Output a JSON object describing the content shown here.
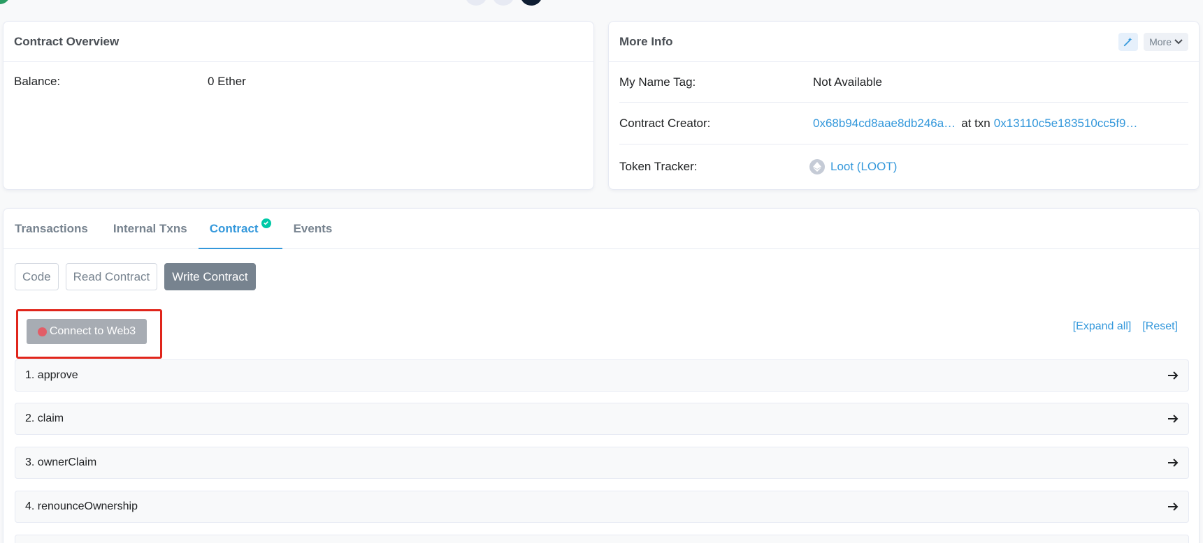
{
  "overview": {
    "title": "Contract Overview",
    "balance_label": "Balance:",
    "balance_value": "0 Ether"
  },
  "more_info": {
    "title": "More Info",
    "more_label": "More",
    "name_tag_label": "My Name Tag:",
    "name_tag_value": "Not Available",
    "creator_label": "Contract Creator:",
    "creator_address": "0x68b94cd8aae8db246a…",
    "at_txn_label": "at txn",
    "creator_txn": "0x13110c5e183510cc5f9…",
    "token_tracker_label": "Token Tracker:",
    "token_tracker_value": "Loot (LOOT)"
  },
  "tabs": [
    {
      "label": "Transactions"
    },
    {
      "label": "Internal Txns"
    },
    {
      "label": "Contract"
    },
    {
      "label": "Events"
    }
  ],
  "active_tab": "Contract",
  "sub_buttons": [
    {
      "label": "Code"
    },
    {
      "label": "Read Contract"
    },
    {
      "label": "Write Contract"
    }
  ],
  "active_sub_button": "Write Contract",
  "connect_button_label": "Connect to Web3",
  "expand_all_label": "[Expand all]",
  "reset_label": "[Reset]",
  "functions": [
    {
      "label": "1. approve"
    },
    {
      "label": "2. claim"
    },
    {
      "label": "3. ownerClaim"
    },
    {
      "label": "4. renounceOwnership"
    }
  ],
  "colors": {
    "link": "#3498db",
    "accent_check": "#00c9a7",
    "highlight_border": "#e0251b",
    "status_dot": "#e25d67"
  }
}
